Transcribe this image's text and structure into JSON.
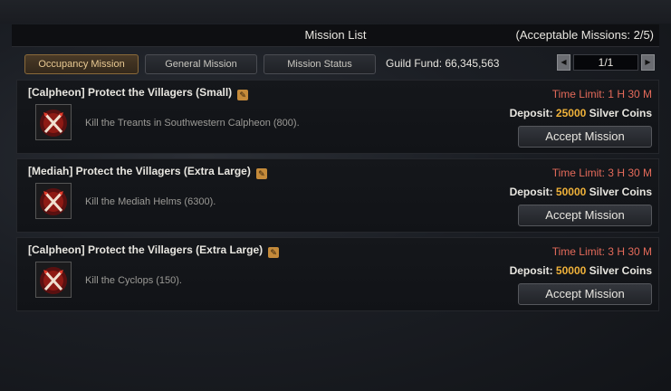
{
  "header": {
    "title": "Mission List",
    "acceptable": "(Acceptable Missions: 2/5)"
  },
  "tabs": [
    "Occupancy Mission",
    "General Mission",
    "Mission Status"
  ],
  "active_tab": "Occupancy Mission",
  "guild_fund": "Guild Fund: 66,345,563",
  "pager": {
    "page": "1/1"
  },
  "missions": [
    {
      "title": "[Calpheon] Protect the Villagers (Small)",
      "description": "Kill the Treants in Southwestern Calpheon (800).",
      "time_limit": "Time Limit: 1 H 30 M",
      "deposit_label": "Deposit:",
      "deposit_amount": "25000",
      "deposit_unit": "Silver Coins",
      "button": "Accept Mission"
    },
    {
      "title": "[Mediah] Protect the Villagers (Extra Large)",
      "description": "Kill the Mediah Helms (6300).",
      "time_limit": "Time Limit: 3 H 30 M",
      "deposit_label": "Deposit:",
      "deposit_amount": "50000",
      "deposit_unit": "Silver Coins",
      "button": "Accept Mission"
    },
    {
      "title": "[Calpheon] Protect the Villagers (Extra Large)",
      "description": "Kill the Cyclops (150).",
      "time_limit": "Time Limit: 3 H 30 M",
      "deposit_label": "Deposit:",
      "deposit_amount": "50000",
      "deposit_unit": "Silver Coins",
      "button": "Accept Mission"
    }
  ],
  "icons": [
    "edit-icon",
    "crossed-swords-emblem-icon",
    "arrow-left-icon",
    "arrow-right-icon"
  ],
  "colors": {
    "time_limit": "#e46a5a",
    "deposit_amount": "#f0b23a",
    "active_tab": "#8a6a3a"
  }
}
